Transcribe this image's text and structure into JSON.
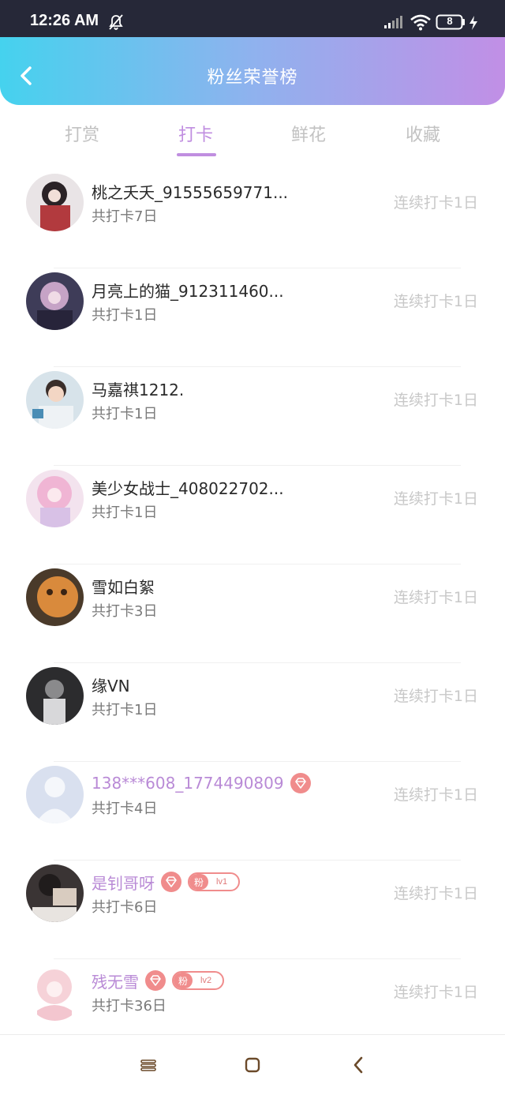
{
  "status_bar": {
    "time": "12:26 AM",
    "battery": "8",
    "icons": [
      "bell-off-icon",
      "signal-icon",
      "wifi-icon",
      "battery-icon",
      "charging-icon"
    ]
  },
  "header": {
    "title": "粉丝荣誉榜",
    "back_icon": "chevron-left-icon",
    "gradient": [
      "#45d2ee",
      "#c18fe6"
    ]
  },
  "tabs": [
    {
      "label": "打赏",
      "active": false
    },
    {
      "label": "打卡",
      "active": true
    },
    {
      "label": "鲜花",
      "active": false
    },
    {
      "label": "收藏",
      "active": false
    }
  ],
  "colors": {
    "accent": "#c08ee0",
    "vip_name": "#b98ad6",
    "badge": "#f08c8c",
    "muted": "#c8c8c8"
  },
  "fans": [
    {
      "name": "桃之夭夭_91555659771...",
      "total": "共打卡7日",
      "streak": "连续打卡1日",
      "vip": false
    },
    {
      "name": "月亮上的猫_912311460...",
      "total": "共打卡1日",
      "streak": "连续打卡1日",
      "vip": false
    },
    {
      "name": "马嘉祺1212.",
      "total": "共打卡1日",
      "streak": "连续打卡1日",
      "vip": false
    },
    {
      "name": "美少女战士_408022702...",
      "total": "共打卡1日",
      "streak": "连续打卡1日",
      "vip": false
    },
    {
      "name": "雪如白絮",
      "total": "共打卡3日",
      "streak": "连续打卡1日",
      "vip": false
    },
    {
      "name": "缘VN",
      "total": "共打卡1日",
      "streak": "连续打卡1日",
      "vip": false
    },
    {
      "name": "138***608_1774490809",
      "total": "共打卡4日",
      "streak": "连续打卡1日",
      "vip": true
    },
    {
      "name": "是钊哥呀",
      "total": "共打卡6日",
      "streak": "连续打卡1日",
      "vip": true,
      "fan_label": "粉",
      "fan_level": "lv1"
    },
    {
      "name": "残无雪",
      "total": "共打卡36日",
      "streak": "连续打卡1日",
      "vip": true,
      "fan_label": "粉",
      "fan_level": "lv2"
    }
  ],
  "navbar": {
    "icons": [
      "menu-icon",
      "home-square-icon",
      "back-triangle-icon"
    ]
  }
}
